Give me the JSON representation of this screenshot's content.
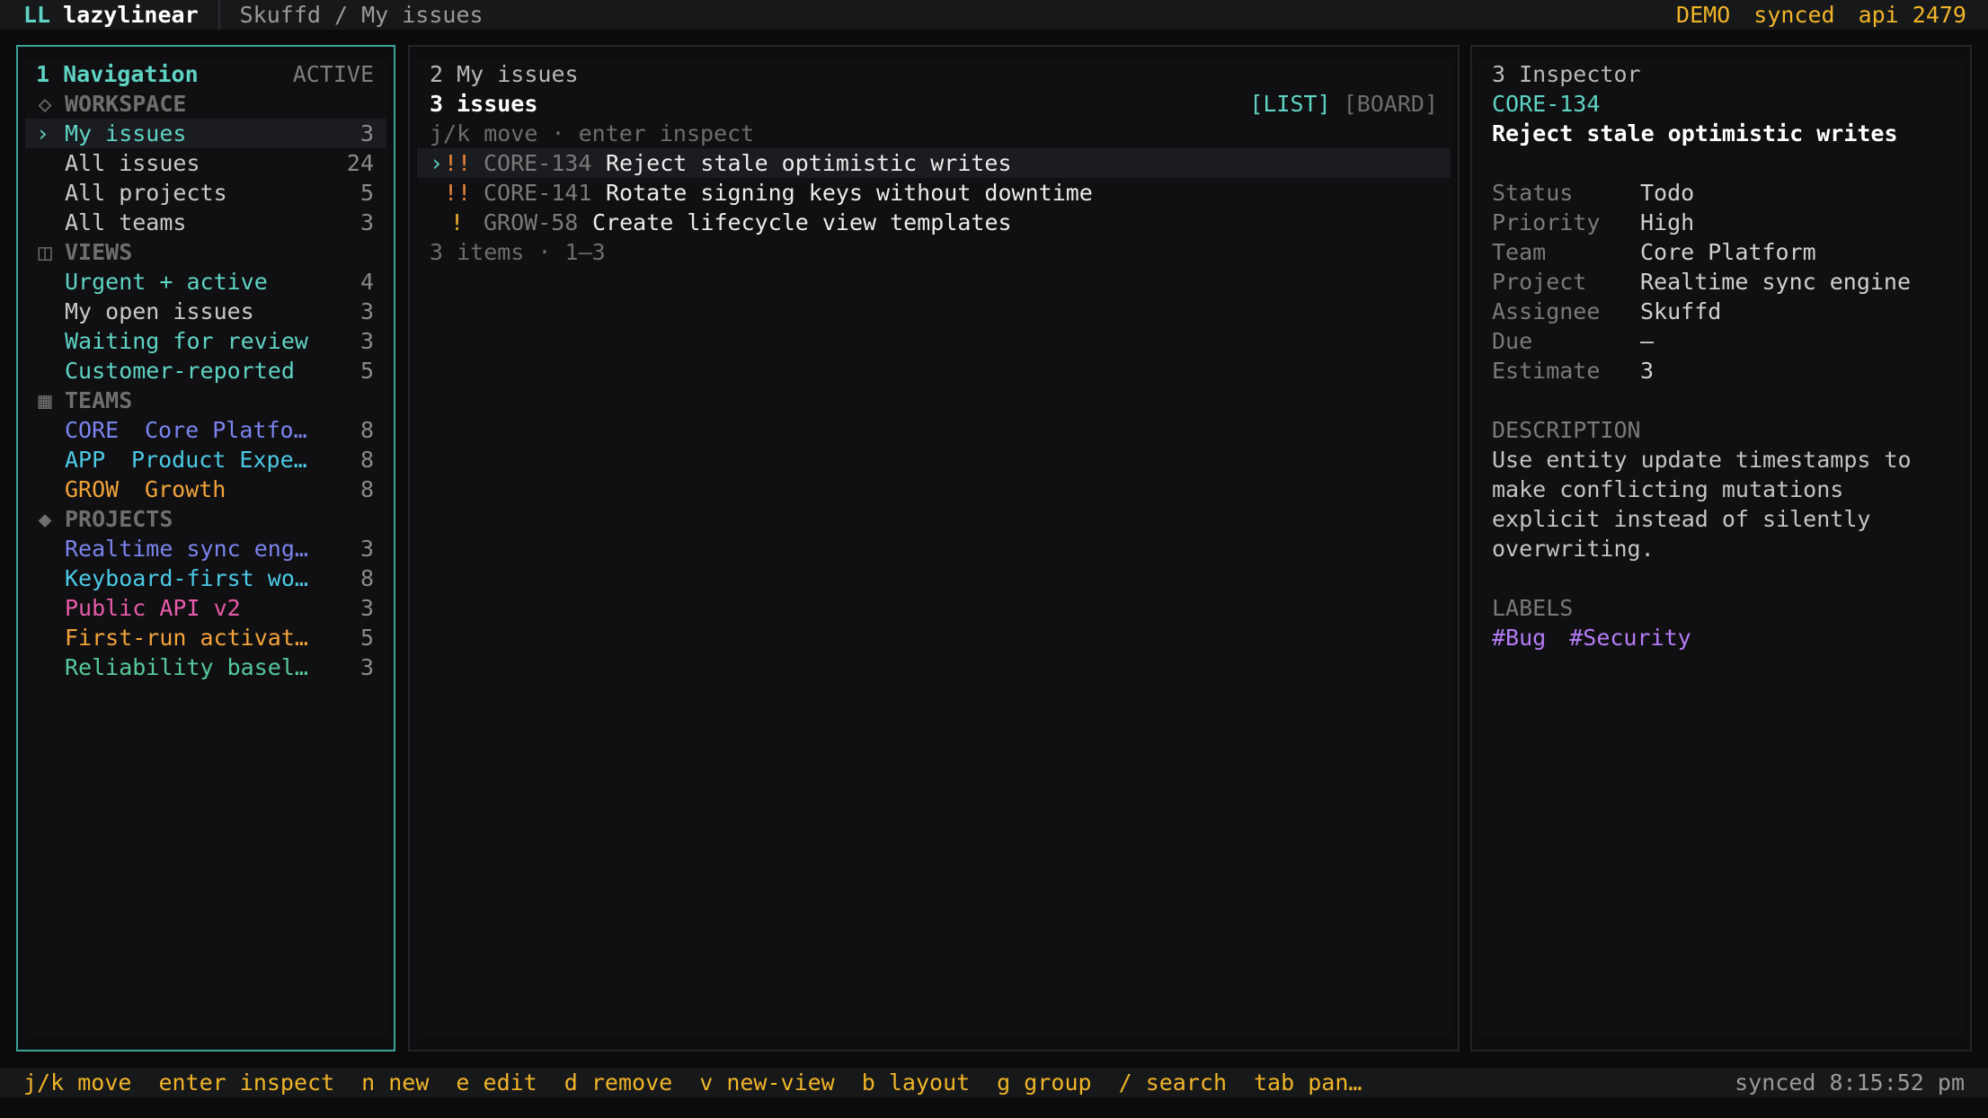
{
  "topbar": {
    "logo": "LL",
    "app_name": "lazylinear",
    "breadcrumb": "Skuffd / My issues",
    "mode": "DEMO",
    "sync": "synced",
    "api": "api 2479"
  },
  "nav": {
    "header": "1 Navigation",
    "state": "ACTIVE",
    "workspace_label": "WORKSPACE",
    "workspace_items": [
      {
        "label": "My issues",
        "count": "3"
      },
      {
        "label": "All issues",
        "count": "24"
      },
      {
        "label": "All projects",
        "count": "5"
      },
      {
        "label": "All teams",
        "count": "3"
      }
    ],
    "views_label": "VIEWS",
    "views": [
      {
        "label": "Urgent + active",
        "count": "4"
      },
      {
        "label": "My open issues",
        "count": "3"
      },
      {
        "label": "Waiting for review",
        "count": "3"
      },
      {
        "label": "Customer-reported",
        "count": "5"
      }
    ],
    "teams_label": "TEAMS",
    "teams": [
      {
        "key": "CORE",
        "name": "Core Platfo…",
        "count": "8",
        "color": "#7b83ee"
      },
      {
        "key": "APP",
        "name": "Product Expe…",
        "count": "8",
        "color": "#4cc9e6"
      },
      {
        "key": "GROW",
        "name": "Growth",
        "count": "8",
        "color": "#f2a33a"
      }
    ],
    "projects_label": "PROJECTS",
    "projects": [
      {
        "label": "Realtime sync eng…",
        "count": "3",
        "color": "#7b83ee"
      },
      {
        "label": "Keyboard-first wo…",
        "count": "8",
        "color": "#4cc9e6"
      },
      {
        "label": "Public API v2",
        "count": "3",
        "color": "#e75ba8"
      },
      {
        "label": "First-run activat…",
        "count": "5",
        "color": "#f2a33a"
      },
      {
        "label": "Reliability basel…",
        "count": "3",
        "color": "#57c99a"
      }
    ]
  },
  "list": {
    "pane_title": "2 My issues",
    "title": "3 issues",
    "layout_list": "[LIST]",
    "layout_board": "[BOARD]",
    "hint": "j/k move · enter inspect",
    "issues": [
      {
        "priority": "!!",
        "key": "CORE-134",
        "title": "Reject stale optimistic writes"
      },
      {
        "priority": "!!",
        "key": "CORE-141",
        "title": "Rotate signing keys without downtime"
      },
      {
        "priority": "!",
        "key": "GROW-58",
        "title": "Create lifecycle view templates"
      }
    ],
    "footer": "3 items · 1–3"
  },
  "inspector": {
    "pane_title": "3 Inspector",
    "key": "CORE-134",
    "title": "Reject stale optimistic writes",
    "fields": [
      {
        "k": "Status",
        "v": "Todo"
      },
      {
        "k": "Priority",
        "v": "High"
      },
      {
        "k": "Team",
        "v": "Core Platform"
      },
      {
        "k": "Project",
        "v": "Realtime sync engine"
      },
      {
        "k": "Assignee",
        "v": "Skuffd"
      },
      {
        "k": "Due",
        "v": "—"
      },
      {
        "k": "Estimate",
        "v": "3"
      }
    ],
    "description_label": "DESCRIPTION",
    "description_lines": [
      "Use entity update timestamps to",
      "make conflicting mutations",
      "explicit instead of silently",
      "overwriting."
    ],
    "labels_label": "LABELS",
    "labels": [
      "#Bug",
      "#Security"
    ]
  },
  "bottombar": {
    "hints": [
      {
        "key": "j/k",
        "label": "move"
      },
      {
        "key": "enter",
        "label": "inspect"
      },
      {
        "key": "n",
        "label": "new"
      },
      {
        "key": "e",
        "label": "edit"
      },
      {
        "key": "d",
        "label": "remove"
      },
      {
        "key": "v",
        "label": "new-view"
      },
      {
        "key": "b",
        "label": "layout"
      },
      {
        "key": "g",
        "label": "group"
      },
      {
        "key": "/",
        "label": "search"
      },
      {
        "key": "tab",
        "label": "pan…"
      }
    ],
    "status": "synced 8:15:52 pm"
  },
  "colors": {
    "accent": "#5fd3c4",
    "warning": "#f0b429",
    "priority_urgent": "#e8863c",
    "label": "#b57cf5"
  }
}
